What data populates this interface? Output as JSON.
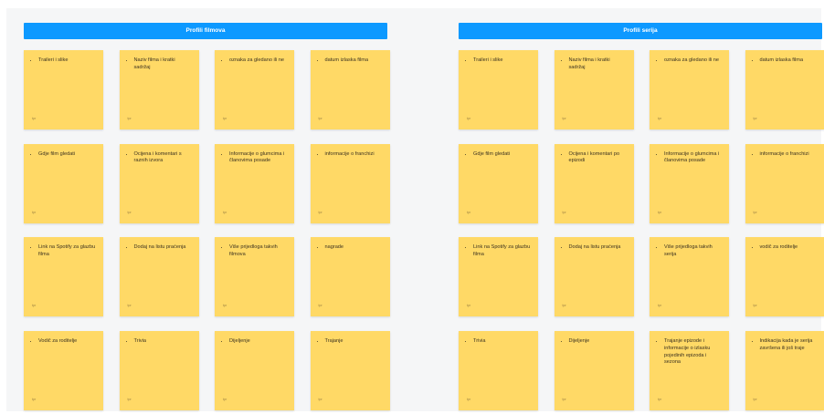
{
  "board": {
    "sections": [
      {
        "id": "filmovi",
        "title": "Profili filmova",
        "notes": [
          {
            "text": "Traileri i slike",
            "author": "tpr"
          },
          {
            "text": "Naziv filma i kratki sadržaj",
            "author": "tpr"
          },
          {
            "text": "oznaka za gledano ili ne",
            "author": "tpr"
          },
          {
            "text": "datum izlaska filma",
            "author": "tpr"
          },
          {
            "text": "Gdje film gledati",
            "author": "tpr"
          },
          {
            "text": "Ocijena i komentari s raznih izvora",
            "author": "tpr"
          },
          {
            "text": "Informacije o glumcima i članovima posade",
            "author": "tpr"
          },
          {
            "text": "informacije o franchizi",
            "author": "tpr"
          },
          {
            "text": "Link na Spotify za glazbu filma",
            "author": "tpr"
          },
          {
            "text": "Dodaj na listu praćenja",
            "author": "tpr"
          },
          {
            "text": "Više prijedloga takvih filmova",
            "author": "tpr"
          },
          {
            "text": "nagrade",
            "author": "tpr"
          },
          {
            "text": "Vodič za roditelje",
            "author": "tpr"
          },
          {
            "text": "Trivia",
            "author": "tpr"
          },
          {
            "text": "Dijeljenje",
            "author": "tpr"
          },
          {
            "text": "Trajanje",
            "author": "tpr"
          }
        ]
      },
      {
        "id": "serije",
        "title": "Profili serija",
        "notes": [
          {
            "text": "Traileri i slike",
            "author": "tpr"
          },
          {
            "text": "Naziv filma i kratki sadržaj",
            "author": "tpr"
          },
          {
            "text": "oznaka za gledano ili ne",
            "author": "tpr"
          },
          {
            "text": "datum izlaska filma",
            "author": "tpr"
          },
          {
            "text": "Gdje film gledati",
            "author": "tpr"
          },
          {
            "text": "Ocijena i komentari po epizodi",
            "author": "tpr"
          },
          {
            "text": "Informacije o glumcima i članovima posade",
            "author": "tpr"
          },
          {
            "text": "informacije o franchizi",
            "author": "tpr"
          },
          {
            "text": "Link na Spotify za glazbu filma",
            "author": "tpr"
          },
          {
            "text": "Dodaj na listu praćenja",
            "author": "tpr"
          },
          {
            "text": "Više prijedloga takvih serija",
            "author": "tpr"
          },
          {
            "text": "vodič za roditelje",
            "author": "tpr"
          },
          {
            "text": "Trivia",
            "author": "tpr"
          },
          {
            "text": "Dijeljenje",
            "author": "tpr"
          },
          {
            "text": "Trajanje epizode i informacije o izlasku pojedinih epizoda i sezona",
            "author": "tpr"
          },
          {
            "text": "Indikacija kada je serija završena ili još traje",
            "author": "tpr"
          }
        ]
      }
    ]
  },
  "colors": {
    "header": "#0d99ff",
    "sticky": "#ffd966",
    "canvas": "#f5f6f7"
  }
}
